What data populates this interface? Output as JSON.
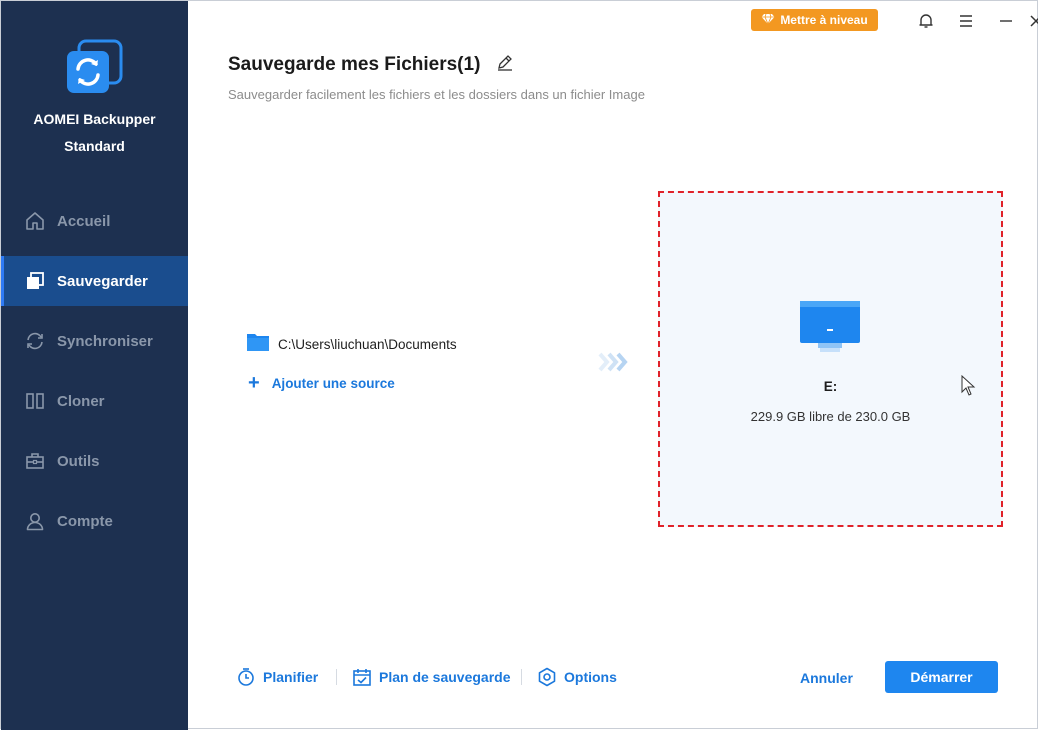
{
  "app": {
    "name": "AOMEI Backupper",
    "edition": "Standard"
  },
  "sidebar": {
    "items": [
      {
        "label": "Accueil",
        "icon": "home-icon",
        "active": false
      },
      {
        "label": "Sauvegarder",
        "icon": "backup-icon",
        "active": true
      },
      {
        "label": "Synchroniser",
        "icon": "sync-icon",
        "active": false
      },
      {
        "label": "Cloner",
        "icon": "clone-icon",
        "active": false
      },
      {
        "label": "Outils",
        "icon": "toolbox-icon",
        "active": false
      },
      {
        "label": "Compte",
        "icon": "user-icon",
        "active": false
      }
    ]
  },
  "topbar": {
    "upgrade_label": "Mettre à niveau"
  },
  "header": {
    "title": "Sauvegarde mes Fichiers(1)",
    "subtitle": "Sauvegarder facilement les fichiers et les dossiers dans un fichier Image"
  },
  "source": {
    "path": "C:\\Users\\liuchuan\\Documents",
    "add_label": "Ajouter une source"
  },
  "destination": {
    "drive": "E:",
    "free_space": "229.9 GB libre de 230.0 GB"
  },
  "bottom": {
    "schedule_label": "Planifier",
    "scheme_label": "Plan de sauvegarde",
    "options_label": "Options",
    "cancel_label": "Annuler",
    "start_label": "Démarrer"
  },
  "colors": {
    "sidebar_bg": "#1d3050",
    "sidebar_active": "#1a4d8e",
    "accent": "#1b78dc",
    "upgrade": "#f39821",
    "dest_border": "#e0222a"
  }
}
